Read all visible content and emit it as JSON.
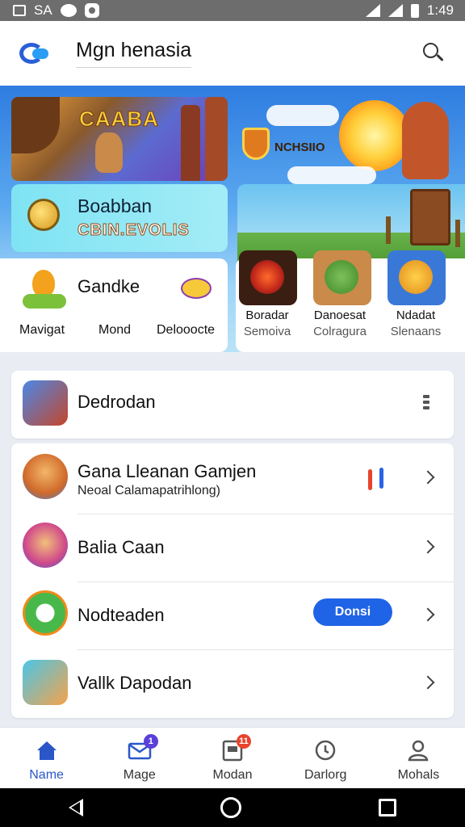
{
  "status_bar": {
    "left_text": "SA",
    "time": "1:49"
  },
  "header": {
    "title": "Mgn henasia"
  },
  "banner": {
    "left_title": "CAABA",
    "right_badge": "NCHSIIO",
    "card_title": "Boabban",
    "card_subtitle": "CBIN.EVOLIS"
  },
  "featured_left": {
    "title": "Gandke",
    "links": [
      "Mavigat",
      "Mond",
      "Delooocte"
    ]
  },
  "featured_games": [
    {
      "name": "Boradar",
      "sub": "Semoiva"
    },
    {
      "name": "Danoesat",
      "sub": "Colragura"
    },
    {
      "name": "Ndadat",
      "sub": "Slenaans"
    }
  ],
  "top_item": {
    "title": "Dedrodan"
  },
  "list": [
    {
      "title": "Gana Lleanan Gamjen",
      "subtitle": "Neoal Calamapatrihlong)"
    },
    {
      "title": "Balia Caan"
    },
    {
      "title": "Nodteaden",
      "button": "Donsi"
    },
    {
      "title": "Vallk Dapodan"
    }
  ],
  "bottom_nav": [
    {
      "label": "Name",
      "icon": "home-icon",
      "badge": ""
    },
    {
      "label": "Mage",
      "icon": "mail-icon",
      "badge": "1"
    },
    {
      "label": "Modan",
      "icon": "news-icon",
      "badge": "11"
    },
    {
      "label": "Darlorg",
      "icon": "clock-icon",
      "badge": ""
    },
    {
      "label": "Mohals",
      "icon": "profile-icon",
      "badge": ""
    }
  ],
  "colors": {
    "accent": "#1f63e6",
    "nav_active": "#2a56c8",
    "badge_purple": "#5b3fd8",
    "badge_red": "#e8432d"
  }
}
